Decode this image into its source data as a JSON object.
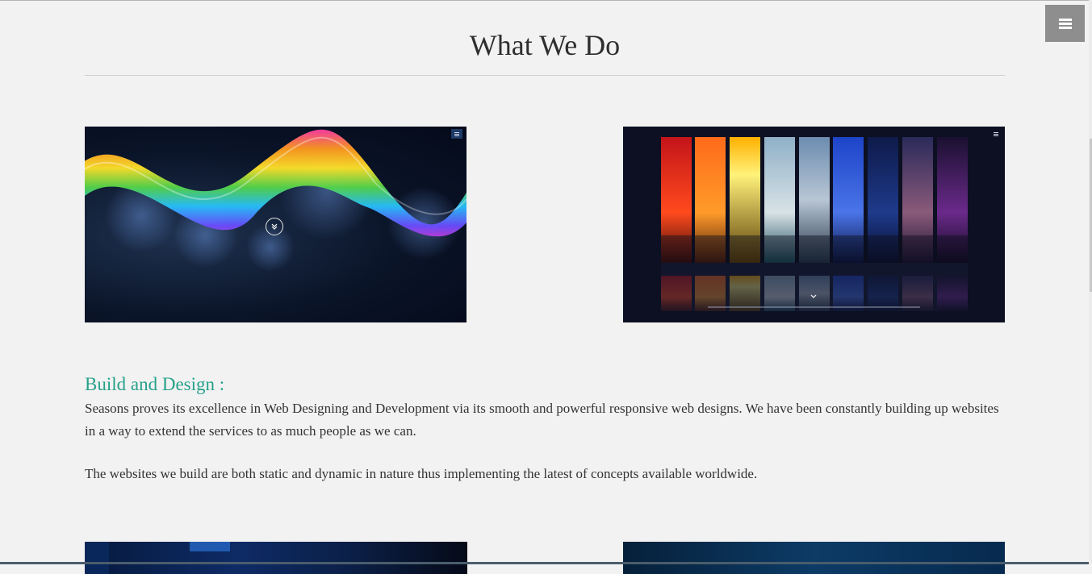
{
  "header": {
    "title": "What We Do",
    "menu_icon": "hamburger-menu-icon"
  },
  "gallery": {
    "items": [
      {
        "name": "rainbow-ribbon",
        "icon": "chevron-double-down-icon"
      },
      {
        "name": "seasons-sky-columns",
        "icon": "chevron-down-icon"
      }
    ]
  },
  "section": {
    "heading": "Build and Design :",
    "paragraph_1": "Seasons proves its excellence in Web Designing and Development via its smooth and powerful responsive web designs. We have been constantly building up websites in a way to extend the services to as much people as we can.",
    "paragraph_2": "The websites we build are both static and dynamic in nature thus implementing the latest of concepts available worldwide."
  },
  "colors": {
    "background": "#f2f2f2",
    "accent_heading": "#26a08a",
    "menu_button": "#8e8e8e",
    "text": "#333333"
  }
}
